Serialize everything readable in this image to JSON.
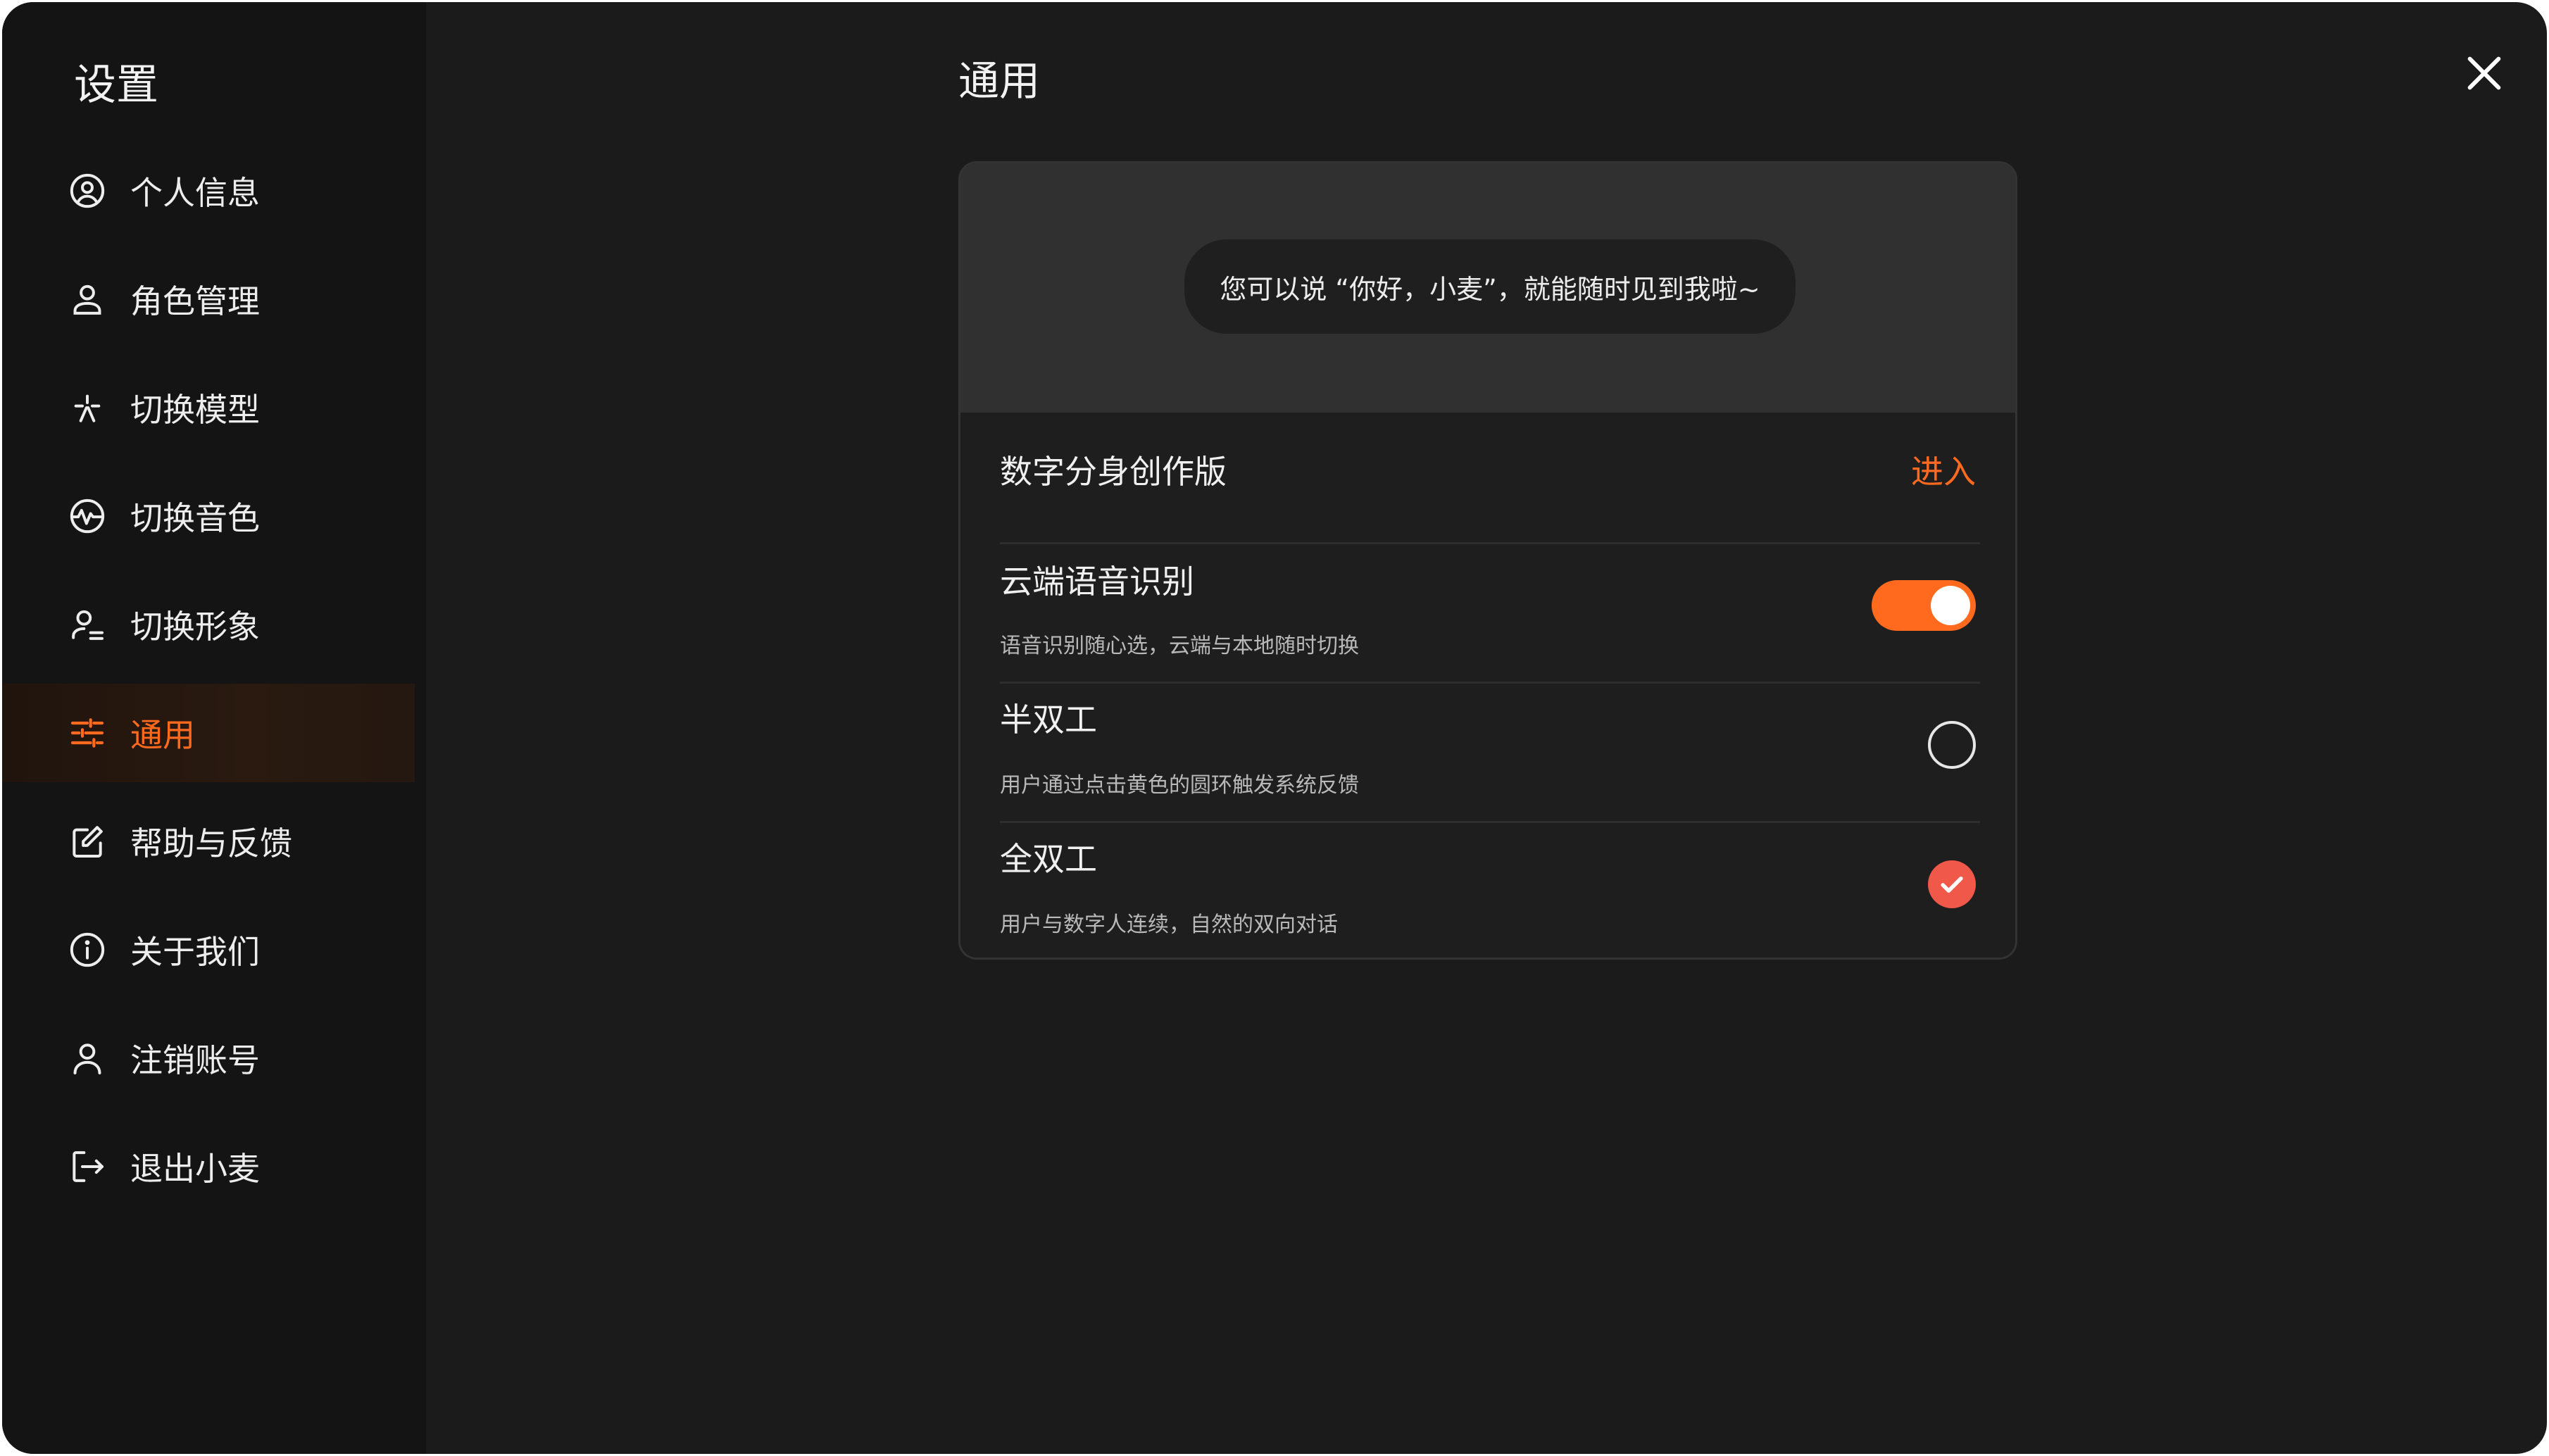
{
  "sidebar": {
    "title": "设置",
    "items": [
      {
        "label": "个人信息",
        "icon": "user-circle-icon"
      },
      {
        "label": "角色管理",
        "icon": "user-icon"
      },
      {
        "label": "切换模型",
        "icon": "sparkle-icon"
      },
      {
        "label": "切换音色",
        "icon": "voice-wave-icon"
      },
      {
        "label": "切换形象",
        "icon": "user-edit-icon"
      },
      {
        "label": "通用",
        "icon": "sliders-icon",
        "active": true
      },
      {
        "label": "帮助与反馈",
        "icon": "edit-icon"
      },
      {
        "label": "关于我们",
        "icon": "info-icon"
      },
      {
        "label": "注销账号",
        "icon": "user-outline-icon"
      },
      {
        "label": "退出小麦",
        "icon": "logout-icon"
      }
    ]
  },
  "main": {
    "title": "通用",
    "preview_bubble": "您可以说 “你好，小麦”，就能随时见到我啦~",
    "settings": {
      "avatar_creator": {
        "title": "数字分身创作版",
        "action": "进入"
      },
      "cloud_asr": {
        "title": "云端语音识别",
        "subtitle": "语音识别随心选，云端与本地随时切换",
        "enabled": true
      },
      "half_duplex": {
        "title": "半双工",
        "subtitle": "用户通过点击黄色的圆环触发系统反馈",
        "selected": false
      },
      "full_duplex": {
        "title": "全双工",
        "subtitle": "用户与数字人连续，自然的双向对话",
        "selected": true
      }
    }
  },
  "colors": {
    "accent": "#ff6a1f",
    "check": "#f0584a",
    "background": "#1b1b1b",
    "sidebar": "#141414"
  }
}
